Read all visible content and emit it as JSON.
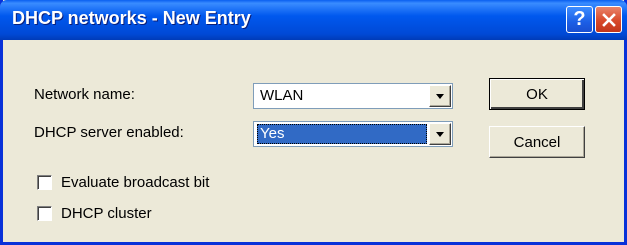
{
  "window": {
    "title": "DHCP networks - New Entry",
    "help_glyph": "?",
    "close_icon": "close-icon"
  },
  "form": {
    "network_name_label": "Network name:",
    "network_name_value": "WLAN",
    "dhcp_server_label": "DHCP server enabled:",
    "dhcp_server_value": "Yes"
  },
  "checkboxes": {
    "broadcast_label": "Evaluate broadcast bit",
    "broadcast_checked": false,
    "cluster_label": "DHCP cluster",
    "cluster_checked": false
  },
  "buttons": {
    "ok_label": "OK",
    "cancel_label": "Cancel"
  },
  "colors": {
    "titlebar": "#0058EE",
    "dialog_bg": "#ECE9D8",
    "selection": "#316AC5",
    "close_button": "#D8492A"
  }
}
